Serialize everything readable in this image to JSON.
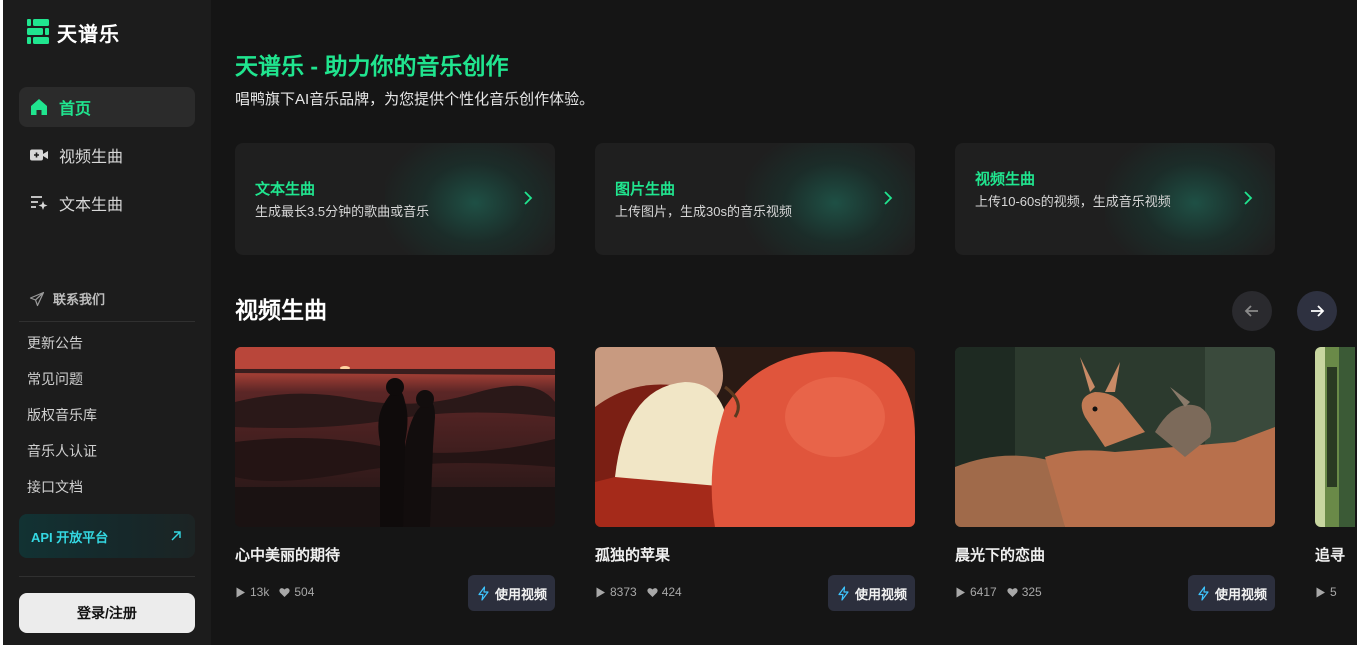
{
  "brand": {
    "name": "天谱乐"
  },
  "nav": [
    {
      "label": "首页",
      "icon": "home-icon",
      "active": true
    },
    {
      "label": "视频生曲",
      "icon": "video-camera-icon",
      "active": false
    },
    {
      "label": "文本生曲",
      "icon": "text-sparkle-icon",
      "active": false
    }
  ],
  "sidebar": {
    "contact_label": "联系我们",
    "links": [
      "更新公告",
      "常见问题",
      "版权音乐库",
      "音乐人认证",
      "接口文档"
    ],
    "api_label": "API 开放平台",
    "login_label": "登录/注册"
  },
  "hero": {
    "title": "天谱乐 - 助力你的音乐创作",
    "subtitle": "唱鸭旗下AI音乐品牌，为您提供个性化音乐创作体验。"
  },
  "features": [
    {
      "title": "文本生曲",
      "desc": "生成最长3.5分钟的歌曲或音乐"
    },
    {
      "title": "图片生曲",
      "desc": "上传图片，生成30s的音乐视频"
    },
    {
      "title": "视频生曲",
      "desc": "上传10-60s的视频，生成音乐视频"
    }
  ],
  "section": {
    "title": "视频生曲"
  },
  "cards": [
    {
      "title": "心中美丽的期待",
      "plays": "13k",
      "likes": "504",
      "button": "使用视频"
    },
    {
      "title": "孤独的苹果",
      "plays": "8373",
      "likes": "424",
      "button": "使用视频"
    },
    {
      "title": "晨光下的恋曲",
      "plays": "6417",
      "likes": "325",
      "button": "使用视频"
    },
    {
      "title": "追寻",
      "plays": "5",
      "likes": "",
      "button": ""
    }
  ],
  "colors": {
    "accent": "#20e58f",
    "background": "#151515",
    "sidebar": "#1c1c1c",
    "api": "#34d8e2"
  }
}
